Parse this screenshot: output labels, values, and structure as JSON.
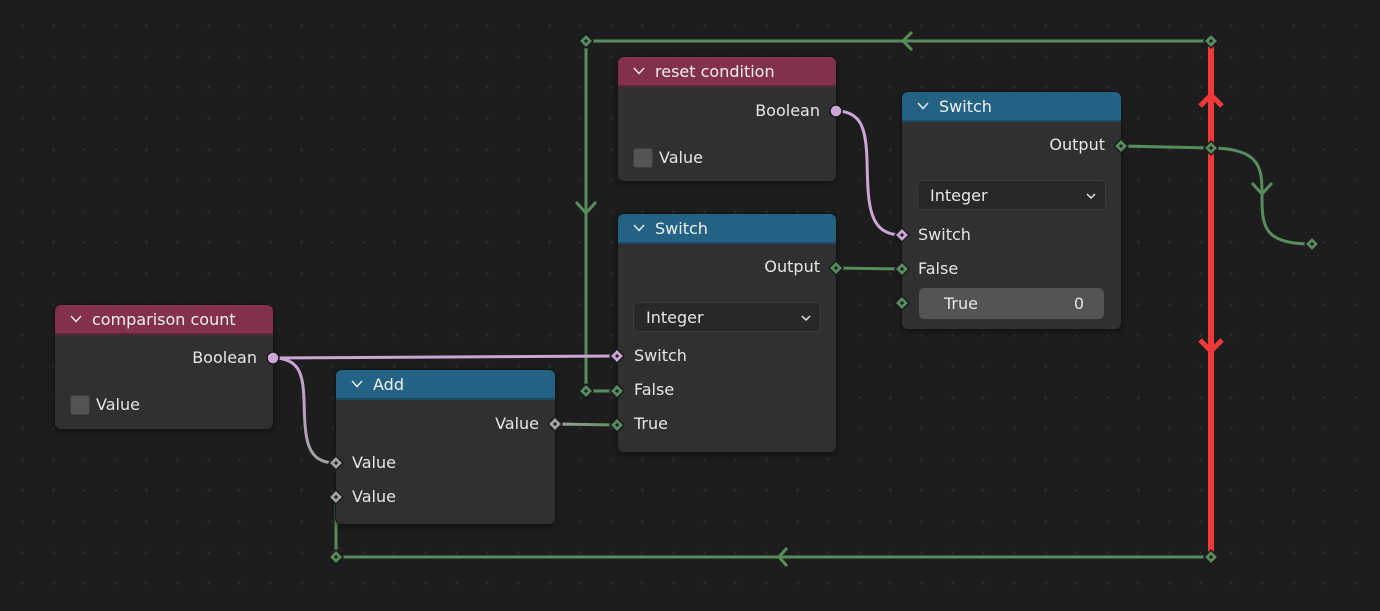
{
  "editor": "Geometry Nodes",
  "colors": {
    "background": "#1d1d1d",
    "node_body": "#303030",
    "header_input": "#83314a",
    "header_utility": "#246283",
    "socket_boolean": "#cca6d6",
    "socket_integer": "#598c5c",
    "socket_float": "#a1a1a1",
    "invalid_link": "#f03a3a"
  },
  "nodes": {
    "comparison_count": {
      "title": "comparison count",
      "output_label": "Boolean",
      "value_label": "Value",
      "value_checked": false
    },
    "reset_condition": {
      "title": "reset condition",
      "output_label": "Boolean",
      "value_label": "Value",
      "value_checked": false
    },
    "add": {
      "title": "Add",
      "output_label": "Value",
      "inputs": [
        "Value",
        "Value"
      ]
    },
    "switch_1": {
      "title": "Switch",
      "output_label": "Output",
      "type_selected": "Integer",
      "inputs": [
        "Switch",
        "False",
        "True"
      ]
    },
    "switch_2": {
      "title": "Switch",
      "output_label": "Output",
      "type_selected": "Integer",
      "inputs": [
        "Switch",
        "False"
      ],
      "true_label": "True",
      "true_value": "0"
    }
  }
}
